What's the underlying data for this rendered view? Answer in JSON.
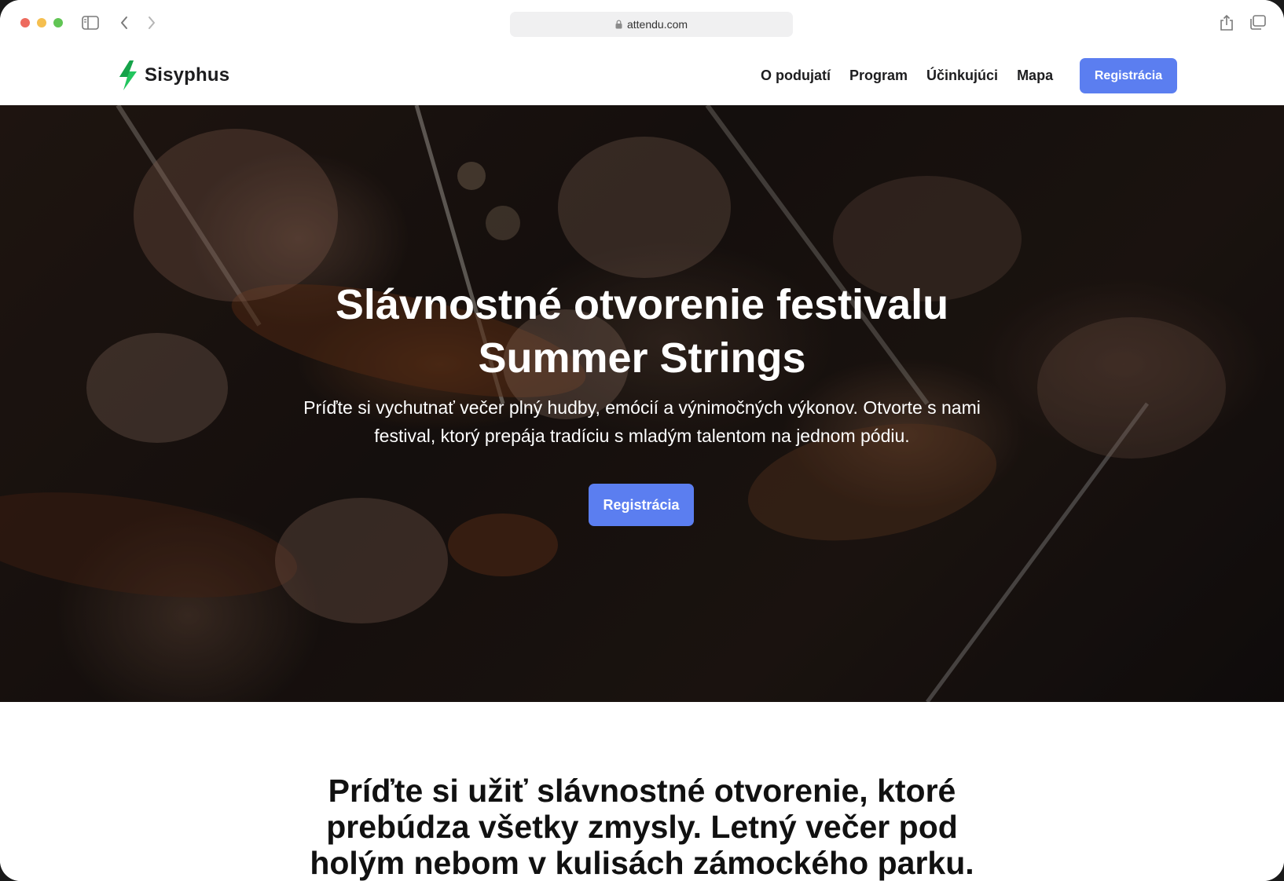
{
  "browser": {
    "url": "attendu.com"
  },
  "site": {
    "brand": "Sisyphus",
    "nav": {
      "links": [
        "O podujatí",
        "Program",
        "Účinkujúci",
        "Mapa"
      ],
      "cta": "Registrácia"
    }
  },
  "hero": {
    "title_line1": "Slávnostné otvorenie festivalu",
    "title_line2": "Summer Strings",
    "subtitle_line1": "Príďte si vychutnať večer plný hudby, emócií a výnimočných výkonov. Otvorte s nami",
    "subtitle_line2": "festival, ktorý prepája tradíciu s mladým talentom na jednom pódiu.",
    "cta": "Registrácia"
  },
  "intro": {
    "line1": "Príďte si užiť slávnostné otvorenie, ktoré",
    "line2": "prebúdza všetky zmysly. Letný večer pod",
    "line3": "holým nebom v kulisách zámockého parku."
  },
  "colors": {
    "accent": "#5b7ef0",
    "brand_green": "#22c55e"
  },
  "icons": {
    "logo": "lightning-bolt-icon",
    "lock": "lock-icon",
    "sidebar": "sidebar-icon",
    "back": "chevron-left-icon",
    "forward": "chevron-right-icon",
    "share": "share-icon",
    "tabs": "tabs-icon"
  }
}
